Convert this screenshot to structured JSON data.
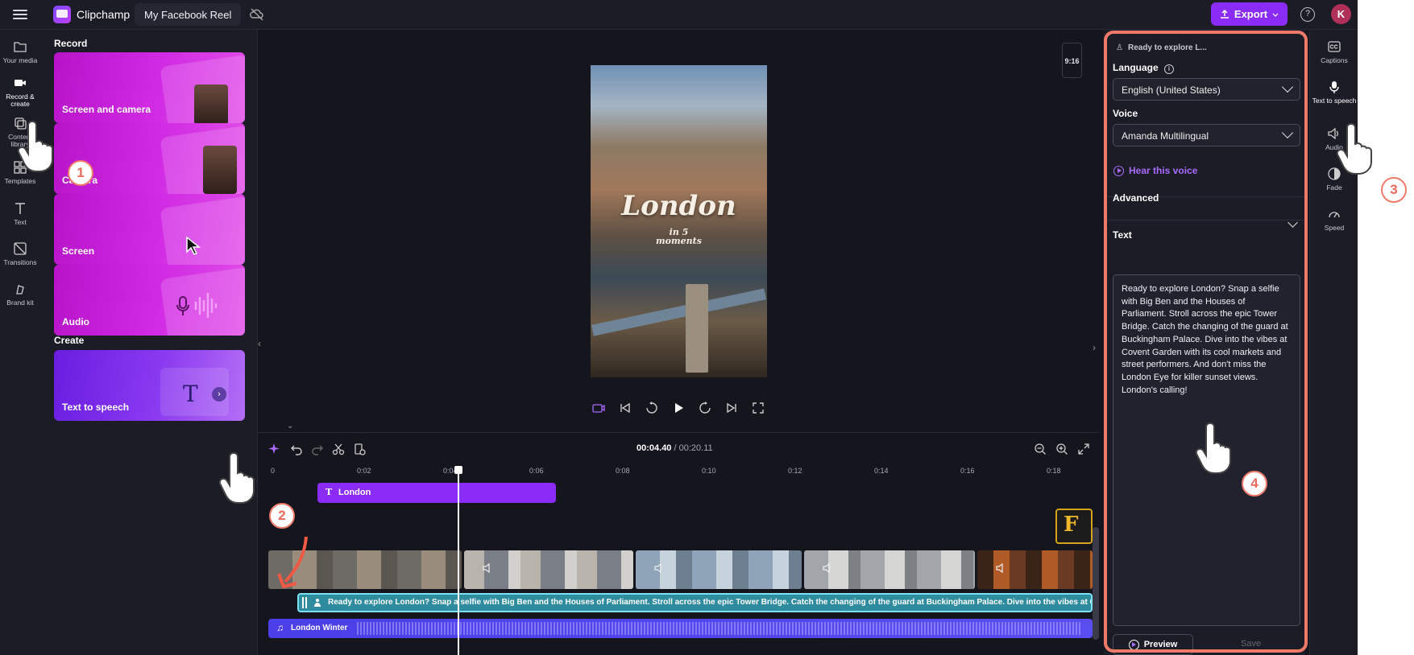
{
  "topbar": {
    "brand": "Clipchamp",
    "project_title": "My Facebook Reel",
    "export_label": "Export",
    "avatar_initial": "K"
  },
  "leftnav": [
    {
      "label": "Your media",
      "icon": "folder-icon"
    },
    {
      "label": "Record & create",
      "icon": "video-camera-icon"
    },
    {
      "label": "Content library",
      "icon": "library-icon"
    },
    {
      "label": "Templates",
      "icon": "templates-icon"
    },
    {
      "label": "Text",
      "icon": "text-icon"
    },
    {
      "label": "Transitions",
      "icon": "transitions-icon"
    },
    {
      "label": "Brand kit",
      "icon": "brand-kit-icon"
    }
  ],
  "panel": {
    "record_title": "Record",
    "create_title": "Create",
    "cards": [
      "Screen and camera",
      "Camera",
      "Screen",
      "Audio"
    ],
    "create_card": "Text to speech"
  },
  "stage": {
    "aspect_ratio": "9:16",
    "preview_title": "London",
    "preview_subtitle_1": "in 5",
    "preview_subtitle_2": "moments"
  },
  "timeline": {
    "current_time": "00:04.40",
    "separator": " / ",
    "duration": "00:20.11",
    "ticks": [
      "0",
      "0:02",
      "0:04",
      "0:06",
      "0:08",
      "0:10",
      "0:12",
      "0:14",
      "0:16",
      "0:18"
    ],
    "text_clip": "London",
    "voiceover_clip": "Ready to explore London? Snap a selfie with Big Ben and the Houses of Parliament. Stroll across the epic Tower Bridge. Catch the changing of the guard at Buckingham Palace. Dive into the vibes at Covent Garden with its",
    "audio_clip": "London Winter",
    "sticker_letter": "F"
  },
  "props": {
    "header": "Ready to explore L...",
    "language_label": "Language",
    "language_value": "English (United States)",
    "voice_label": "Voice",
    "voice_value": "Amanda Multilingual",
    "hear_voice": "Hear this voice",
    "advanced_label": "Advanced",
    "text_label": "Text",
    "text_value": "Ready to explore London? Snap a selfie with Big Ben and the Houses of Parliament. Stroll across the epic Tower Bridge. Catch the changing of the guard at Buckingham Palace. Dive into the vibes at Covent Garden with its cool markets and street performers. And don't miss the London Eye for killer sunset views. London's calling!",
    "preview_label": "Preview",
    "save_label": "Save"
  },
  "rightrail": [
    {
      "label": "Captions",
      "icon": "captions-icon"
    },
    {
      "label": "Text to speech",
      "icon": "text-to-speech-icon"
    },
    {
      "label": "Audio",
      "icon": "speaker-icon"
    },
    {
      "label": "Fade",
      "icon": "fade-icon"
    },
    {
      "label": "Speed",
      "icon": "speed-icon"
    }
  ],
  "steps": [
    "1",
    "2",
    "3",
    "4"
  ],
  "colors": {
    "accent": "#8a2cf6",
    "highlight": "#f07a6a",
    "voiceover": "#2f8b9e",
    "audio": "#4a3fe8"
  }
}
